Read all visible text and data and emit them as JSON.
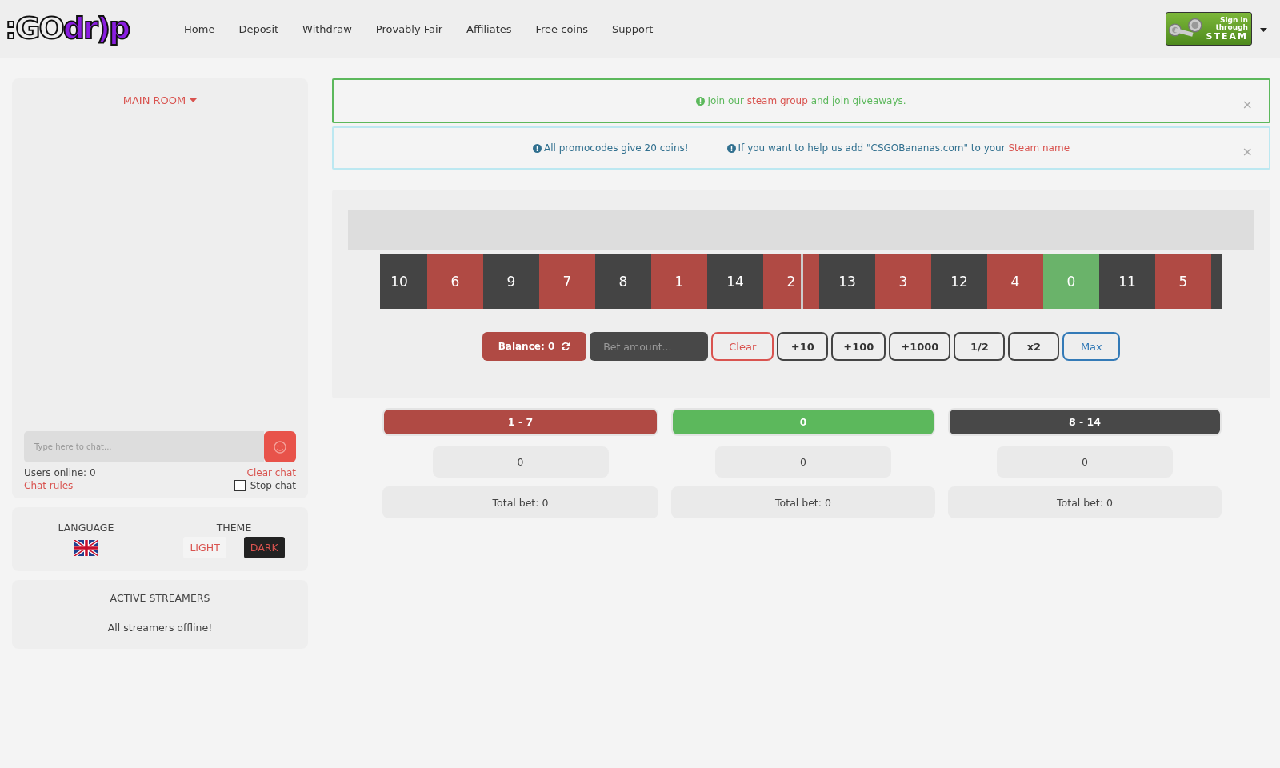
{
  "header": {
    "logo": {
      "light": ":GO",
      "purple": "dr)p"
    },
    "nav": [
      {
        "label": "Home"
      },
      {
        "label": "Deposit"
      },
      {
        "label": "Withdraw"
      },
      {
        "label": "Provably Fair"
      },
      {
        "label": "Affiliates"
      },
      {
        "label": "Free coins"
      },
      {
        "label": "Support"
      }
    ],
    "sign_in": [
      "Sign in",
      "through",
      "STEAM"
    ]
  },
  "chat": {
    "room": "MAIN ROOM",
    "placeholder": "Type here to chat...",
    "users_online": "Users online: 0",
    "clear_chat": "Clear chat",
    "chat_rules": "Chat rules",
    "stop_chat": {
      "label": "Stop chat",
      "checked": false
    }
  },
  "settings": {
    "language_title": "LANGUAGE",
    "theme_title": "THEME",
    "themes": [
      {
        "label": "LIGHT",
        "selected": false
      },
      {
        "label": "DARK",
        "selected": true
      }
    ]
  },
  "streamers": {
    "title": "ACTIVE STREAMERS",
    "message": "All streamers offline!"
  },
  "alerts": [
    {
      "kind": "success",
      "close": "×",
      "messages": [
        {
          "before": "Join our ",
          "link": "steam group",
          "after": " and join giveaways."
        }
      ]
    },
    {
      "kind": "info",
      "close": "×",
      "messages": [
        {
          "before": "All promocodes give 20 coins!"
        },
        {
          "before": "If you want to help us add \"CSGOBananas.com\" to your ",
          "link": "Steam name"
        }
      ]
    }
  ],
  "roulette": {
    "tiles": [
      {
        "number": "10",
        "kind": "black"
      },
      {
        "number": "6",
        "kind": "red"
      },
      {
        "number": "9",
        "kind": "black"
      },
      {
        "number": "7",
        "kind": "red"
      },
      {
        "number": "8",
        "kind": "black"
      },
      {
        "number": "1",
        "kind": "red"
      },
      {
        "number": "14",
        "kind": "black"
      },
      {
        "number": "2",
        "kind": "red"
      },
      {
        "number": "13",
        "kind": "black"
      },
      {
        "number": "3",
        "kind": "red"
      },
      {
        "number": "12",
        "kind": "black"
      },
      {
        "number": "4",
        "kind": "red"
      },
      {
        "number": "0",
        "kind": "green"
      },
      {
        "number": "11",
        "kind": "black"
      },
      {
        "number": "5",
        "kind": "red"
      }
    ]
  },
  "controls": {
    "balance": "Balance: 0",
    "bet_placeholder": "Bet amount...",
    "buttons": [
      {
        "label": "Clear",
        "kind": "clear"
      },
      {
        "label": "+10",
        "kind": "plain"
      },
      {
        "label": "+100",
        "kind": "plain"
      },
      {
        "label": "+1000",
        "kind": "plain"
      },
      {
        "label": "1/2",
        "kind": "plain"
      },
      {
        "label": "x2",
        "kind": "plain"
      },
      {
        "label": "Max",
        "kind": "max"
      }
    ]
  },
  "bets": [
    {
      "label": "1 - 7",
      "kind": "red",
      "amount": "0",
      "total": "Total bet: 0"
    },
    {
      "label": "0",
      "kind": "green",
      "amount": "0",
      "total": "Total bet: 0"
    },
    {
      "label": "8 - 14",
      "kind": "black",
      "amount": "0",
      "total": "Total bet: 0"
    }
  ]
}
